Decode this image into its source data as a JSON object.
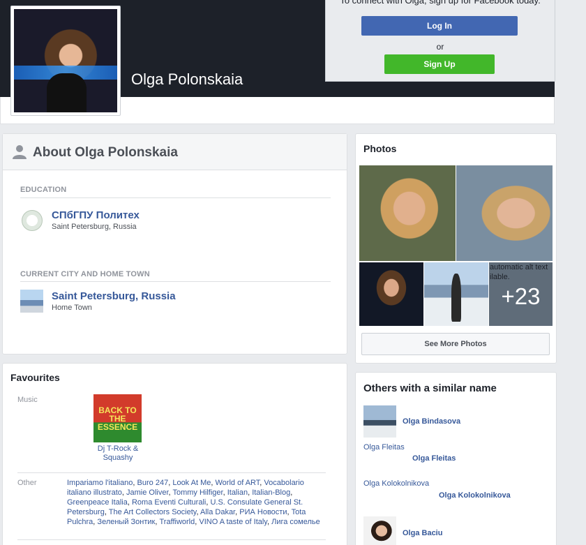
{
  "cover": {
    "profile_name": "Olga Polonskaia",
    "signup_text": "To connect with Olga, sign up for Facebook today.",
    "login_label": "Log In",
    "or_text": "or",
    "signup_label": "Sign Up"
  },
  "about": {
    "title": "About Olga Polonskaia",
    "education_label": "EDUCATION",
    "education": {
      "name": "СПбГПУ Политех",
      "location": "Saint Petersburg, Russia"
    },
    "city_label": "CURRENT CITY AND HOME TOWN",
    "city": {
      "name": "Saint Petersburg, Russia",
      "sub": "Home Town"
    }
  },
  "favourites": {
    "title": "Favourites",
    "music_label": "Music",
    "album_cover_text": "BACK TO THE ESSENCE",
    "album_caption": "Dj T-Rock & Squashy",
    "other_label": "Other",
    "other_items": [
      "Impariamo l'italiano",
      "Buro 247",
      "Look At Me",
      "World of ART",
      "Vocabolario italiano illustrato",
      "Jamie Oliver",
      "Tommy Hilfiger",
      "Italian",
      "Italian-Blog",
      "Greenpeace Italia",
      "Roma Eventi Culturali",
      "U.S. Consulate General St. Petersburg",
      "The Art Collectors Society",
      "Alla Dakar",
      "РИА Новости",
      "Tota Pulchra",
      "Зеленый Зонтик",
      "Traffiworld",
      "VINO A taste of Italy",
      "Лига сомелье"
    ]
  },
  "photos": {
    "title": "Photos",
    "alt_text": "automatic alt text\nilable.",
    "more_count": "+23",
    "see_more": "See More Photos"
  },
  "similar": {
    "title": "Others with a similar name",
    "people": [
      {
        "small_link": "",
        "name": "Olga Bindasova"
      },
      {
        "small_link": "Olga Fleitas",
        "name": "Olga Fleitas"
      },
      {
        "small_link": "Olga Kolokolnikova",
        "name": "Olga Kolokolnikova"
      },
      {
        "small_link": "",
        "name": "Olga Baciu"
      }
    ]
  },
  "colors": {
    "facebook_blue": "#4267b2",
    "signup_green": "#42b72a",
    "link_blue": "#365899"
  }
}
